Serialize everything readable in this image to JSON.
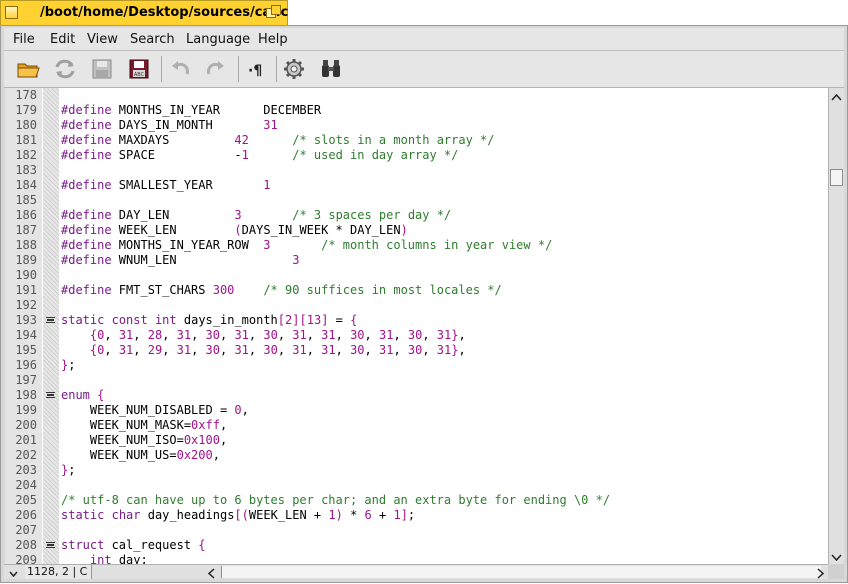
{
  "window": {
    "title": "/boot/home/Desktop/sources/cal.c"
  },
  "menubar": {
    "items": [
      "File",
      "Edit",
      "View",
      "Search",
      "Language",
      "Help"
    ]
  },
  "toolbar": {
    "buttons": [
      "open-folder-icon",
      "reload-icon",
      "save-icon",
      "save-as-icon",
      "undo-icon",
      "redo-icon",
      "show-whitespace-icon",
      "settings-icon",
      "find-icon"
    ]
  },
  "statusbar": {
    "position": "1128, 2 | C"
  },
  "colors": {
    "keyword": "#7a1a8a",
    "comment": "#2f7d2f",
    "number": "#a0128a",
    "tab_yellow": "#ffd232"
  },
  "editor": {
    "lines": [
      {
        "num": "178",
        "fold": false,
        "text": ""
      },
      {
        "num": "179",
        "fold": false,
        "text": "#define MONTHS_IN_YEAR      DECEMBER"
      },
      {
        "num": "180",
        "fold": false,
        "text": "#define DAYS_IN_MONTH       31"
      },
      {
        "num": "181",
        "fold": false,
        "text": "#define MAXDAYS         42      /* slots in a month array */"
      },
      {
        "num": "182",
        "fold": false,
        "text": "#define SPACE           -1      /* used in day array */"
      },
      {
        "num": "183",
        "fold": false,
        "text": ""
      },
      {
        "num": "184",
        "fold": false,
        "text": "#define SMALLEST_YEAR       1"
      },
      {
        "num": "185",
        "fold": false,
        "text": ""
      },
      {
        "num": "186",
        "fold": false,
        "text": "#define DAY_LEN         3       /* 3 spaces per day */"
      },
      {
        "num": "187",
        "fold": false,
        "text": "#define WEEK_LEN        (DAYS_IN_WEEK * DAY_LEN)"
      },
      {
        "num": "188",
        "fold": false,
        "text": "#define MONTHS_IN_YEAR_ROW  3       /* month columns in year view */"
      },
      {
        "num": "189",
        "fold": false,
        "text": "#define WNUM_LEN                3"
      },
      {
        "num": "190",
        "fold": false,
        "text": ""
      },
      {
        "num": "191",
        "fold": false,
        "text": "#define FMT_ST_CHARS 300    /* 90 suffices in most locales */"
      },
      {
        "num": "192",
        "fold": false,
        "text": ""
      },
      {
        "num": "193",
        "fold": true,
        "text": "static const int days_in_month[2][13] = {"
      },
      {
        "num": "194",
        "fold": false,
        "text": "    {0, 31, 28, 31, 30, 31, 30, 31, 31, 30, 31, 30, 31},"
      },
      {
        "num": "195",
        "fold": false,
        "text": "    {0, 31, 29, 31, 30, 31, 30, 31, 31, 30, 31, 30, 31},"
      },
      {
        "num": "196",
        "fold": false,
        "text": "};"
      },
      {
        "num": "197",
        "fold": false,
        "text": ""
      },
      {
        "num": "198",
        "fold": true,
        "text": "enum {"
      },
      {
        "num": "199",
        "fold": false,
        "text": "    WEEK_NUM_DISABLED = 0,"
      },
      {
        "num": "200",
        "fold": false,
        "text": "    WEEK_NUM_MASK=0xff,"
      },
      {
        "num": "201",
        "fold": false,
        "text": "    WEEK_NUM_ISO=0x100,"
      },
      {
        "num": "202",
        "fold": false,
        "text": "    WEEK_NUM_US=0x200,"
      },
      {
        "num": "203",
        "fold": false,
        "text": "};"
      },
      {
        "num": "204",
        "fold": false,
        "text": ""
      },
      {
        "num": "205",
        "fold": false,
        "text": "/* utf-8 can have up to 6 bytes per char; and an extra byte for ending \\0 */"
      },
      {
        "num": "206",
        "fold": false,
        "text": "static char day_headings[(WEEK_LEN + 1) * 6 + 1];"
      },
      {
        "num": "207",
        "fold": false,
        "text": ""
      },
      {
        "num": "208",
        "fold": true,
        "text": "struct cal_request {"
      },
      {
        "num": "209",
        "fold": false,
        "text": "    int day;"
      }
    ]
  }
}
